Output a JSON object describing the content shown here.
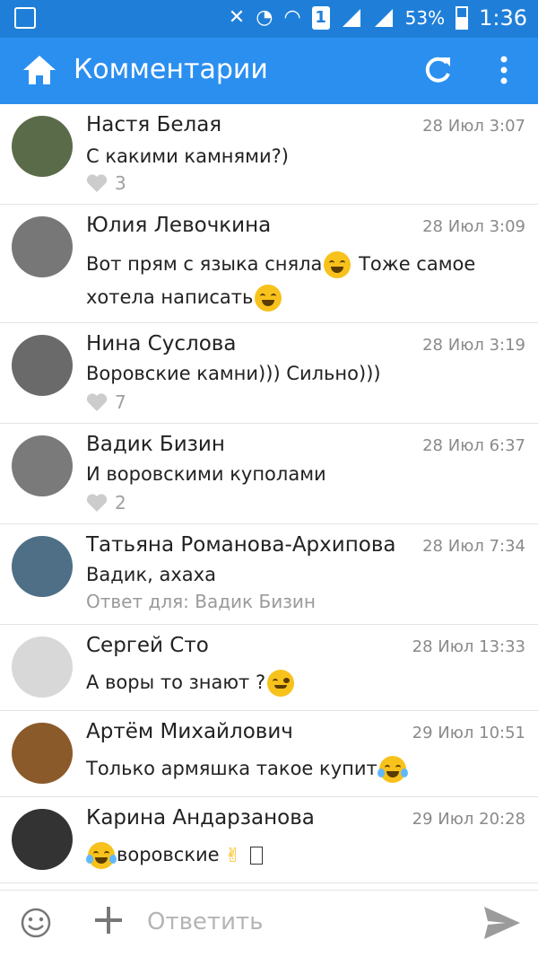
{
  "status_bar": {
    "battery": "53%",
    "time": "1:36",
    "sim": "1"
  },
  "app_bar": {
    "title": "Комментарии",
    "home_icon": "home-icon",
    "refresh_icon": "refresh-icon",
    "more_icon": "more-vertical-icon"
  },
  "comments": [
    {
      "name": "Настя Белая",
      "time": "28 Июл 3:07",
      "text_parts": [
        "С какими камнями?)"
      ],
      "likes": "3",
      "reply_to": "",
      "avatar_color": "#5a6b4a"
    },
    {
      "name": "Юлия Левочкина",
      "time": "28 Июл 3:09",
      "text_parts": [
        "Вот прям с языка сняла",
        "Тоже самое хотела написать"
      ],
      "likes": "",
      "reply_to": "",
      "avatar_color": "#777"
    },
    {
      "name": "Нина Суслова",
      "time": "28 Июл 3:19",
      "text_parts": [
        "Воровские камни))) Сильно)))"
      ],
      "likes": "7",
      "reply_to": "",
      "avatar_color": "#6a6a6a"
    },
    {
      "name": "Вадик Бизин",
      "time": "28 Июл 6:37",
      "text_parts": [
        "И воровскими куполами"
      ],
      "likes": "2",
      "reply_to": "",
      "avatar_color": "#7a7a7a"
    },
    {
      "name": "Татьяна Романова-Архипова",
      "time": "28 Июл 7:34",
      "text_parts": [
        "Вадик, ахаха"
      ],
      "likes": "",
      "reply_to": "Ответ для: Вадик Бизин",
      "avatar_color": "#4e6f86"
    },
    {
      "name": "Сергей Сто",
      "time": "28 Июл 13:33",
      "text_parts": [
        "А воры то знают ?"
      ],
      "likes": "",
      "reply_to": "",
      "avatar_color": "#d8d8d8"
    },
    {
      "name": "Артём Михайлович",
      "time": "29 Июл 10:51",
      "text_parts": [
        "Только армяшка такое купит"
      ],
      "likes": "",
      "reply_to": "",
      "avatar_color": "#8b5a2b"
    },
    {
      "name": "Карина Андарзанова",
      "time": "29 Июл 20:28",
      "text_parts": [
        "воровские"
      ],
      "likes": "",
      "reply_to": "",
      "avatar_color": "#333"
    }
  ],
  "composer": {
    "placeholder": "Ответить"
  }
}
